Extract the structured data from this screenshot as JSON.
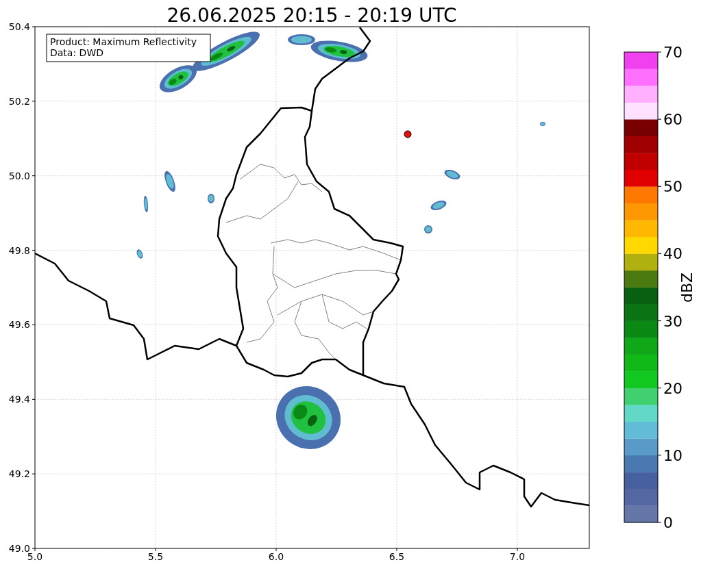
{
  "title": "26.06.2025 20:15 - 20:19 UTC",
  "info_box": [
    "Product: Maximum Reflectivity",
    "Data: DWD"
  ],
  "x_ticks": [
    "5.0",
    "5.5",
    "6.0",
    "6.5",
    "7.0"
  ],
  "y_ticks": [
    "50.4",
    "50.2",
    "50.0",
    "49.8",
    "49.6",
    "49.4",
    "49.2",
    "49.0"
  ],
  "colorbar": {
    "label": "dBZ",
    "ticks": [
      "70",
      "60",
      "50",
      "40",
      "30",
      "20",
      "10",
      "0"
    ],
    "bands": [
      {
        "color": "#6477a8"
      },
      {
        "color": "#5567a3"
      },
      {
        "color": "#4660a0"
      },
      {
        "color": "#4a78b0"
      },
      {
        "color": "#5a9ac8"
      },
      {
        "color": "#62bcd8"
      },
      {
        "color": "#62d8c8"
      },
      {
        "color": "#40d070"
      },
      {
        "color": "#10c820"
      },
      {
        "color": "#10b818"
      },
      {
        "color": "#10a818"
      },
      {
        "color": "#0a8a14"
      },
      {
        "color": "#0a7414"
      },
      {
        "color": "#086010"
      },
      {
        "color": "#4a7a10"
      },
      {
        "color": "#b0b010"
      },
      {
        "color": "#ffd800"
      },
      {
        "color": "#ffb800"
      },
      {
        "color": "#ff9800"
      },
      {
        "color": "#ff7800"
      },
      {
        "color": "#e00000"
      },
      {
        "color": "#c00000"
      },
      {
        "color": "#a00000"
      },
      {
        "color": "#780000"
      },
      {
        "color": "#ffe0ff"
      },
      {
        "color": "#ffb0ff"
      },
      {
        "color": "#ff70ff"
      },
      {
        "color": "#f040f0"
      }
    ]
  }
}
